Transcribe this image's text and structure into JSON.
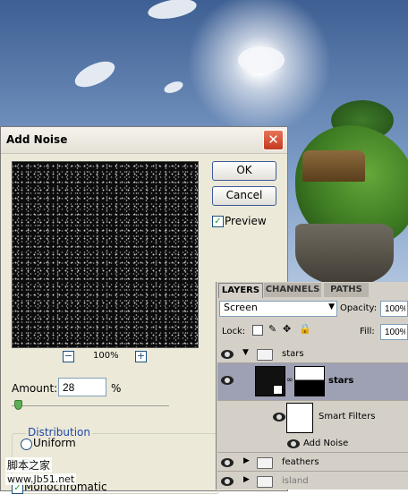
{
  "dialog": {
    "title": "Add Noise",
    "close_glyph": "✕",
    "ok_label": "OK",
    "cancel_label": "Cancel",
    "preview_label": "Preview",
    "preview_checked": true,
    "zoom_out_glyph": "−",
    "zoom_in_glyph": "+",
    "zoom_level": "100%",
    "amount_label": "Amount:",
    "amount_value": "28",
    "amount_unit": "%",
    "amount_slider_fraction": 0.03,
    "distribution_label": "Distribution",
    "uniform_label": "Uniform",
    "monochromatic_label": "Monochromatic",
    "monochromatic_checked": true
  },
  "layers_panel": {
    "tabs": [
      "LAYERS",
      "CHANNELS",
      "PATHS"
    ],
    "active_tab": "LAYERS",
    "blend_mode": "Screen",
    "opacity_label": "Opacity:",
    "opacity_value": "100%",
    "lock_label": "Lock:",
    "fill_label": "Fill:",
    "fill_value": "100%",
    "layers": [
      {
        "name": "stars",
        "kind": "group"
      },
      {
        "name": "stars",
        "kind": "layer"
      },
      {
        "name": "Smart Filters",
        "kind": "smart-filters"
      },
      {
        "name": "Add Noise",
        "kind": "filter"
      },
      {
        "name": "feathers",
        "kind": "group"
      },
      {
        "name": "island",
        "kind": "group"
      }
    ]
  },
  "watermark": {
    "chinese": "脚本之家",
    "url": "www.Jb51.net"
  },
  "colors": {
    "dialog_bg": "#ece9d8",
    "panel_bg": "#d4d0c8",
    "selected_row": "#9ea0b4",
    "close_button": "#c23a1e"
  }
}
